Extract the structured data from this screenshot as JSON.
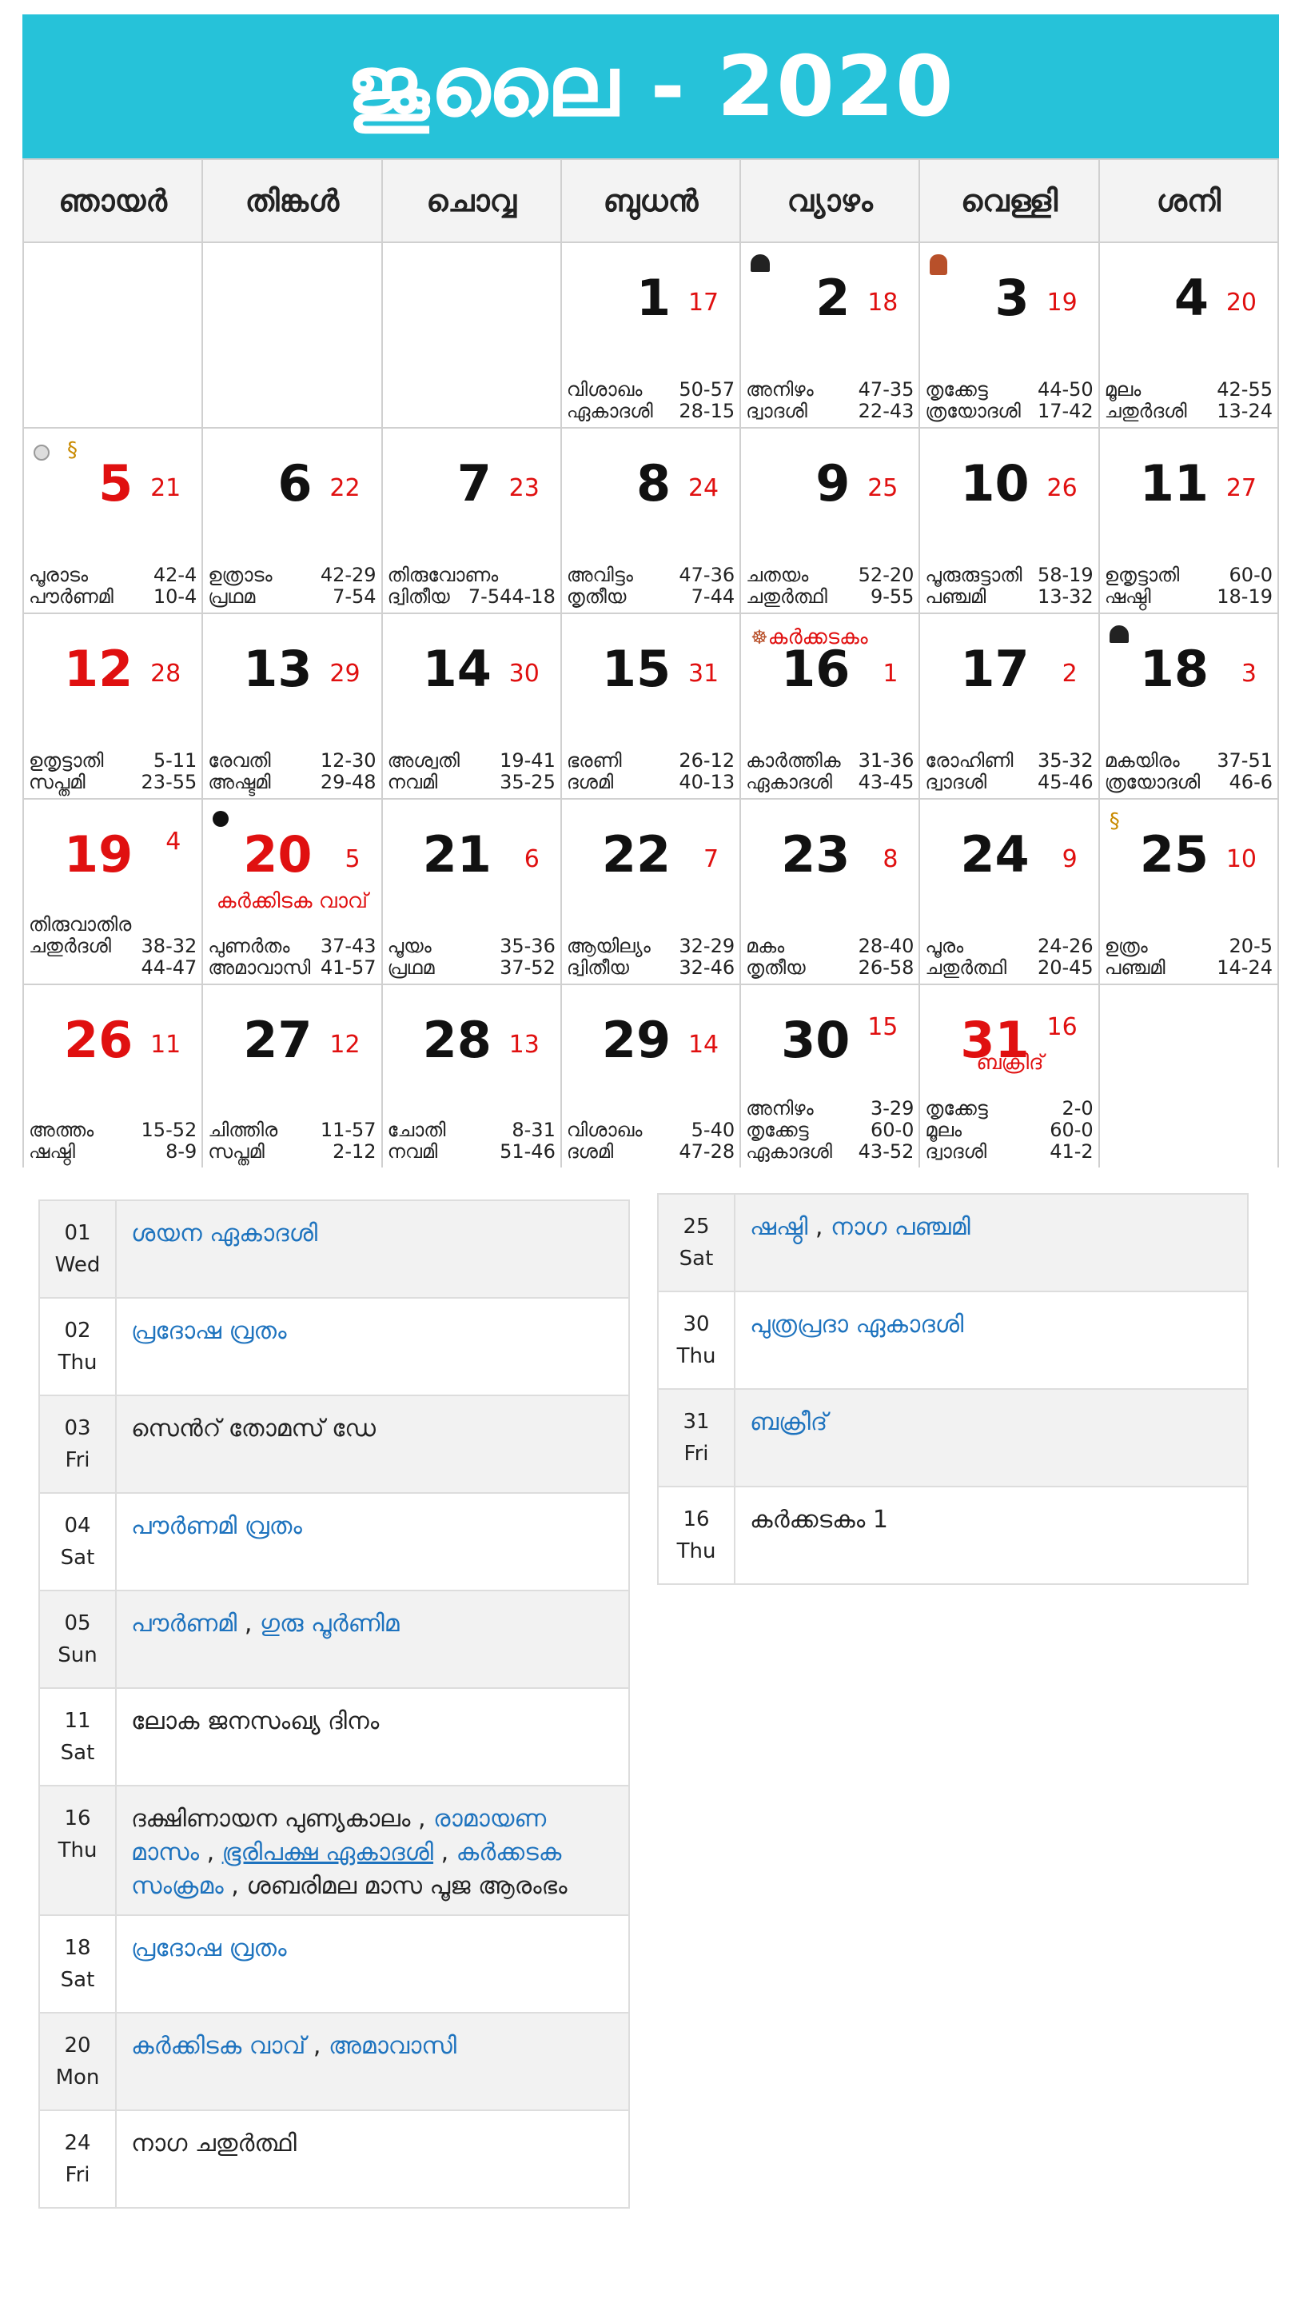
{
  "header": {
    "title": "ജൂലൈ - 2020",
    "bg": "#26c2d9"
  },
  "weekdays": [
    "ഞായർ",
    "തിങ്കൾ",
    "ചൊവ്വ",
    "ബുധൻ",
    "വ്യാഴം",
    "വെള്ളി",
    "ശനി"
  ],
  "cells": {
    "d1": {
      "day": "1",
      "mday": "17",
      "r1a": "വിശാഖം",
      "r1b": "50-57",
      "r2a": "ഏകാദശി",
      "r2b": "28-15"
    },
    "d2": {
      "day": "2",
      "mday": "18",
      "r1a": "അനിഴം",
      "r1b": "47-35",
      "r2a": "ദ്വാദശി",
      "r2b": "22-43"
    },
    "d3": {
      "day": "3",
      "mday": "19",
      "r1a": "തൃക്കേട്ട",
      "r1b": "44-50",
      "r2a": "ത്രയോദശി",
      "r2b": "17-42"
    },
    "d4": {
      "day": "4",
      "mday": "20",
      "r1a": "മൂലം",
      "r1b": "42-55",
      "r2a": "ചതുർദശി",
      "r2b": "13-24"
    },
    "d5": {
      "day": "5",
      "mday": "21",
      "r1a": "പൂരാടം",
      "r1b": "42-4",
      "r2a": "പൗർണമി",
      "r2b": "10-4"
    },
    "d6": {
      "day": "6",
      "mday": "22",
      "r1a": "ഉത്രാടം",
      "r1b": "42-29",
      "r2a": "പ്രഥമ",
      "r2b": "7-54"
    },
    "d7": {
      "day": "7",
      "mday": "23",
      "r1a": "തിരുവോണം",
      "r1b": "",
      "r2a": "ദ്വിതീയ",
      "r2b": "7-544-18"
    },
    "d8": {
      "day": "8",
      "mday": "24",
      "r1a": "അവിട്ടം",
      "r1b": "47-36",
      "r2a": "തൃതീയ",
      "r2b": "7-44"
    },
    "d9": {
      "day": "9",
      "mday": "25",
      "r1a": "ചതയം",
      "r1b": "52-20",
      "r2a": "ചതുർത്ഥി",
      "r2b": "9-55"
    },
    "d10": {
      "day": "10",
      "mday": "26",
      "r1a": "പൂരുരുട്ടാതി",
      "r1b": "58-19",
      "r2a": "പഞ്ചമി",
      "r2b": "13-32"
    },
    "d11": {
      "day": "11",
      "mday": "27",
      "r1a": "ഉതൃട്ടാതി",
      "r1b": "60-0",
      "r2a": "ഷഷ്ഠി",
      "r2b": "18-19"
    },
    "d12": {
      "day": "12",
      "mday": "28",
      "r1a": "ഉതൃട്ടാതി",
      "r1b": "5-11",
      "r2a": "സപ്തമി",
      "r2b": "23-55"
    },
    "d13": {
      "day": "13",
      "mday": "29",
      "r1a": "രേവതി",
      "r1b": "12-30",
      "r2a": "അഷ്ടമി",
      "r2b": "29-48"
    },
    "d14": {
      "day": "14",
      "mday": "30",
      "r1a": "അശ്വതി",
      "r1b": "19-41",
      "r2a": "നവമി",
      "r2b": "35-25"
    },
    "d15": {
      "day": "15",
      "mday": "31",
      "r1a": "ഭരണി",
      "r1b": "26-12",
      "r2a": "ദശമി",
      "r2b": "40-13"
    },
    "d16": {
      "day": "16",
      "mday": "1",
      "label": "കർക്കടകം",
      "r1a": "കാർത്തിക",
      "r1b": "31-36",
      "r2a": "ഏകാദശി",
      "r2b": "43-45"
    },
    "d17": {
      "day": "17",
      "mday": "2",
      "r1a": "രോഹിണി",
      "r1b": "35-32",
      "r2a": "ദ്വാദശി",
      "r2b": "45-46"
    },
    "d18": {
      "day": "18",
      "mday": "3",
      "r1a": "മകയിരം",
      "r1b": "37-51",
      "r2a": "ത്രയോദശി",
      "r2b": "46-6"
    },
    "d19": {
      "day": "19",
      "mday": "4",
      "r1a": "തിരുവാതിര",
      "r1b": "",
      "r2a": "ചതുർദശി",
      "r2b": "38-32",
      "r3a": "",
      "r3b": "44-47"
    },
    "d20": {
      "day": "20",
      "mday": "5",
      "sub": "കർക്കിടക വാവ്",
      "r1a": "പുണർതം",
      "r1b": "37-43",
      "r2a": "അമാവാസി",
      "r2b": "41-57"
    },
    "d21": {
      "day": "21",
      "mday": "6",
      "r1a": "പൂയം",
      "r1b": "35-36",
      "r2a": "പ്രഥമ",
      "r2b": "37-52"
    },
    "d22": {
      "day": "22",
      "mday": "7",
      "r1a": "ആയില്യം",
      "r1b": "32-29",
      "r2a": "ദ്വിതീയ",
      "r2b": "32-46"
    },
    "d23": {
      "day": "23",
      "mday": "8",
      "r1a": "മകം",
      "r1b": "28-40",
      "r2a": "തൃതീയ",
      "r2b": "26-58"
    },
    "d24": {
      "day": "24",
      "mday": "9",
      "r1a": "പൂരം",
      "r1b": "24-26",
      "r2a": "ചതുർത്ഥി",
      "r2b": "20-45"
    },
    "d25": {
      "day": "25",
      "mday": "10",
      "r1a": "ഉത്രം",
      "r1b": "20-5",
      "r2a": "പഞ്ചമി",
      "r2b": "14-24"
    },
    "d26": {
      "day": "26",
      "mday": "11",
      "r1a": "അത്തം",
      "r1b": "15-52",
      "r2a": "ഷഷ്ഠി",
      "r2b": "8-9"
    },
    "d27": {
      "day": "27",
      "mday": "12",
      "r1a": "ചിത്തിര",
      "r1b": "11-57",
      "r2a": "സപ്തമി",
      "r2b": "2-12"
    },
    "d28": {
      "day": "28",
      "mday": "13",
      "r1a": "ചോതി",
      "r1b": "8-31",
      "r2a": "നവമി",
      "r2b": "51-46"
    },
    "d29": {
      "day": "29",
      "mday": "14",
      "r1a": "വിശാഖം",
      "r1b": "5-40",
      "r2a": "ദശമി",
      "r2b": "47-28"
    },
    "d30": {
      "day": "30",
      "mday": "15",
      "r1a": "അനിഴം",
      "r1b": "3-29",
      "r2a": "തൃക്കേട്ട",
      "r2b": "60-0",
      "r3a": "ഏകാദശി",
      "r3b": "43-52"
    },
    "d31": {
      "day": "31",
      "mday": "16",
      "sub": "ബക്രീദ്",
      "r1a": "തൃക്കേട്ട",
      "r1b": "2-0",
      "r2a": "മൂലം",
      "r2b": "60-0",
      "r3a": "ദ്വാദശി",
      "r3b": "41-2"
    }
  },
  "list_left": [
    {
      "d": "01",
      "w": "Wed",
      "t1": "ശയന ഏകാദശി"
    },
    {
      "d": "02",
      "w": "Thu",
      "t1": "പ്രദോഷ വ്രതം"
    },
    {
      "d": "03",
      "w": "Fri",
      "t1": "സെൻറ് തോമസ് ഡേ"
    },
    {
      "d": "04",
      "w": "Sat",
      "t1": "പൗർണമി വ്രതം"
    },
    {
      "d": "05",
      "w": "Sun",
      "t1": "പൗർണമി",
      "t2": "ഗുരു പൂർണിമ"
    },
    {
      "d": "11",
      "w": "Sat",
      "t1": "ലോക ജനസംഖ്യ ദിനം"
    },
    {
      "d": "16",
      "w": "Thu",
      "t1": "ദക്ഷിണായന പുണ്യകാലം",
      "t2": "രാമായണ മാസം",
      "t3": "ഭൂരിപക്ഷ ഏകാദശി",
      "t4": "കർക്കടക സംക്രമം",
      "t5": "ശബരിമല മാസ പൂജ ആരംഭം"
    },
    {
      "d": "18",
      "w": "Sat",
      "t1": "പ്രദോഷ വ്രതം"
    },
    {
      "d": "20",
      "w": "Mon",
      "t1": "കർക്കിടക വാവ്",
      "t2": "അമാവാസി"
    },
    {
      "d": "24",
      "w": "Fri",
      "t1": "നാഗ ചതുർത്ഥി"
    }
  ],
  "list_right": [
    {
      "d": "25",
      "w": "Sat",
      "t1": "ഷഷ്ഠി",
      "t2": "നാഗ പഞ്ചമി"
    },
    {
      "d": "30",
      "w": "Thu",
      "t1": "പുത്രപ്രദാ ഏകാദശി"
    },
    {
      "d": "31",
      "w": "Fri",
      "t1": "ബക്രീദ്"
    },
    {
      "d": "16",
      "w": "Thu",
      "t1": "കർക്കടകം 1"
    }
  ],
  "sep": " , ",
  "icons": [
    "temple-icon",
    "deity-icon",
    "full-moon-icon",
    "snake-icon",
    "new-moon-icon",
    "sage-icon"
  ]
}
